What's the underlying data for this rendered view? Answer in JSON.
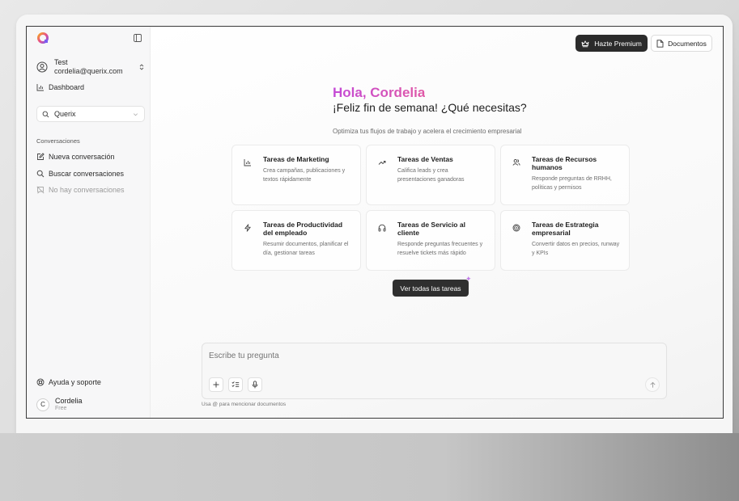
{
  "sidebar": {
    "user_name": "Test",
    "user_email": "cordelia@querix.com",
    "dashboard_label": "Dashboard",
    "workspace_selected": "Querix",
    "section_label": "Conversaciones",
    "new_conversation_label": "Nueva conversación",
    "search_conversations_label": "Buscar conversaciones",
    "empty_label": "No hay conversaciones",
    "help_label": "Ayuda y soporte",
    "footer_user": {
      "initial": "C",
      "name": "Cordelia",
      "plan": "Free"
    }
  },
  "header": {
    "premium_label": "Hazte Premium",
    "documents_label": "Documentos"
  },
  "main": {
    "greeting": "Hola, Cordelia",
    "subgreeting": "¡Feliz fin de semana! ¿Qué necesitas?",
    "tagline": "Optimiza tus flujos de trabajo y acelera el crecimiento empresarial",
    "cards": [
      {
        "icon": "bar-chart-icon",
        "title": "Tareas de Marketing",
        "desc": "Crea campañas, publicaciones y textos rápidamente"
      },
      {
        "icon": "trending-up-icon",
        "title": "Tareas de Ventas",
        "desc": "Califica leads y crea presentaciones ganadoras"
      },
      {
        "icon": "users-icon",
        "title": "Tareas de Recursos humanos",
        "desc": "Responde preguntas de RRHH, políticas y permisos"
      },
      {
        "icon": "lightning-icon",
        "title": "Tareas de Productividad del empleado",
        "desc": "Resumir documentos, planificar el día, gestionar tareas"
      },
      {
        "icon": "headphones-icon",
        "title": "Tareas de Servicio al cliente",
        "desc": "Responde preguntas frecuentes y resuelve tickets más rápido"
      },
      {
        "icon": "target-icon",
        "title": "Tareas de Estrategia empresarial",
        "desc": "Convertir datos en precios, runway y KPIs"
      }
    ],
    "view_all_label": "Ver todas las tareas"
  },
  "composer": {
    "placeholder": "Escribe tu pregunta",
    "hint": "Usa @ para mencionar documentos"
  },
  "colors": {
    "accent_gradient_start": "#c44ad6",
    "accent_gradient_end": "#e058a6",
    "dark_button": "#2b2b2b"
  }
}
